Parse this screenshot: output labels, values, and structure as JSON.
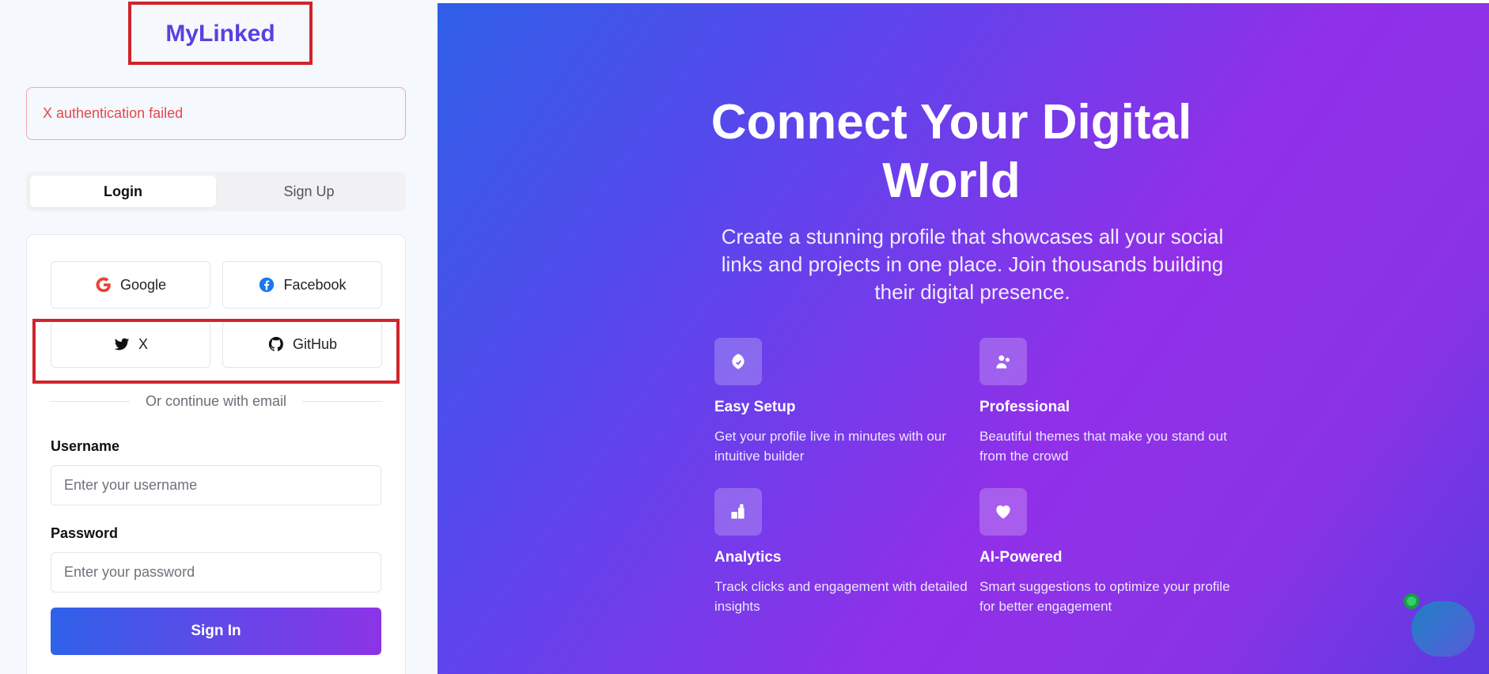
{
  "brand": {
    "logo_text": "MyLinked"
  },
  "alert": {
    "message": "X authentication failed"
  },
  "tabs": [
    {
      "label": "Login",
      "active": true
    },
    {
      "label": "Sign Up",
      "active": false
    }
  ],
  "social": {
    "google": "Google",
    "facebook": "Facebook",
    "x": "X",
    "github": "GitHub"
  },
  "divider_text": "Or continue with email",
  "form": {
    "username_label": "Username",
    "username_placeholder": "Enter your username",
    "password_label": "Password",
    "password_placeholder": "Enter your password",
    "submit_label": "Sign In"
  },
  "hero": {
    "title_line1": "Connect Your Digital",
    "title_line2": "World",
    "subtitle": "Create a stunning profile that showcases all your social links and projects in one place. Join thousands building their digital presence."
  },
  "features": [
    {
      "title": "Easy Setup",
      "desc": "Get your profile live in minutes with our intuitive builder",
      "icon": "rocket-icon"
    },
    {
      "title": "Professional",
      "desc": "Beautiful themes that make you stand out from the crowd",
      "icon": "users-icon"
    },
    {
      "title": "Analytics",
      "desc": "Track clicks and engagement with detailed insights",
      "icon": "chart-icon"
    },
    {
      "title": "AI-Powered",
      "desc": "Smart suggestions to optimize your profile for better engagement",
      "icon": "heart-icon"
    }
  ],
  "colors": {
    "brand": "#5b3fe0",
    "error": "#e5484d",
    "highlight_box": "#d0242b",
    "online": "#2fcf6a"
  }
}
